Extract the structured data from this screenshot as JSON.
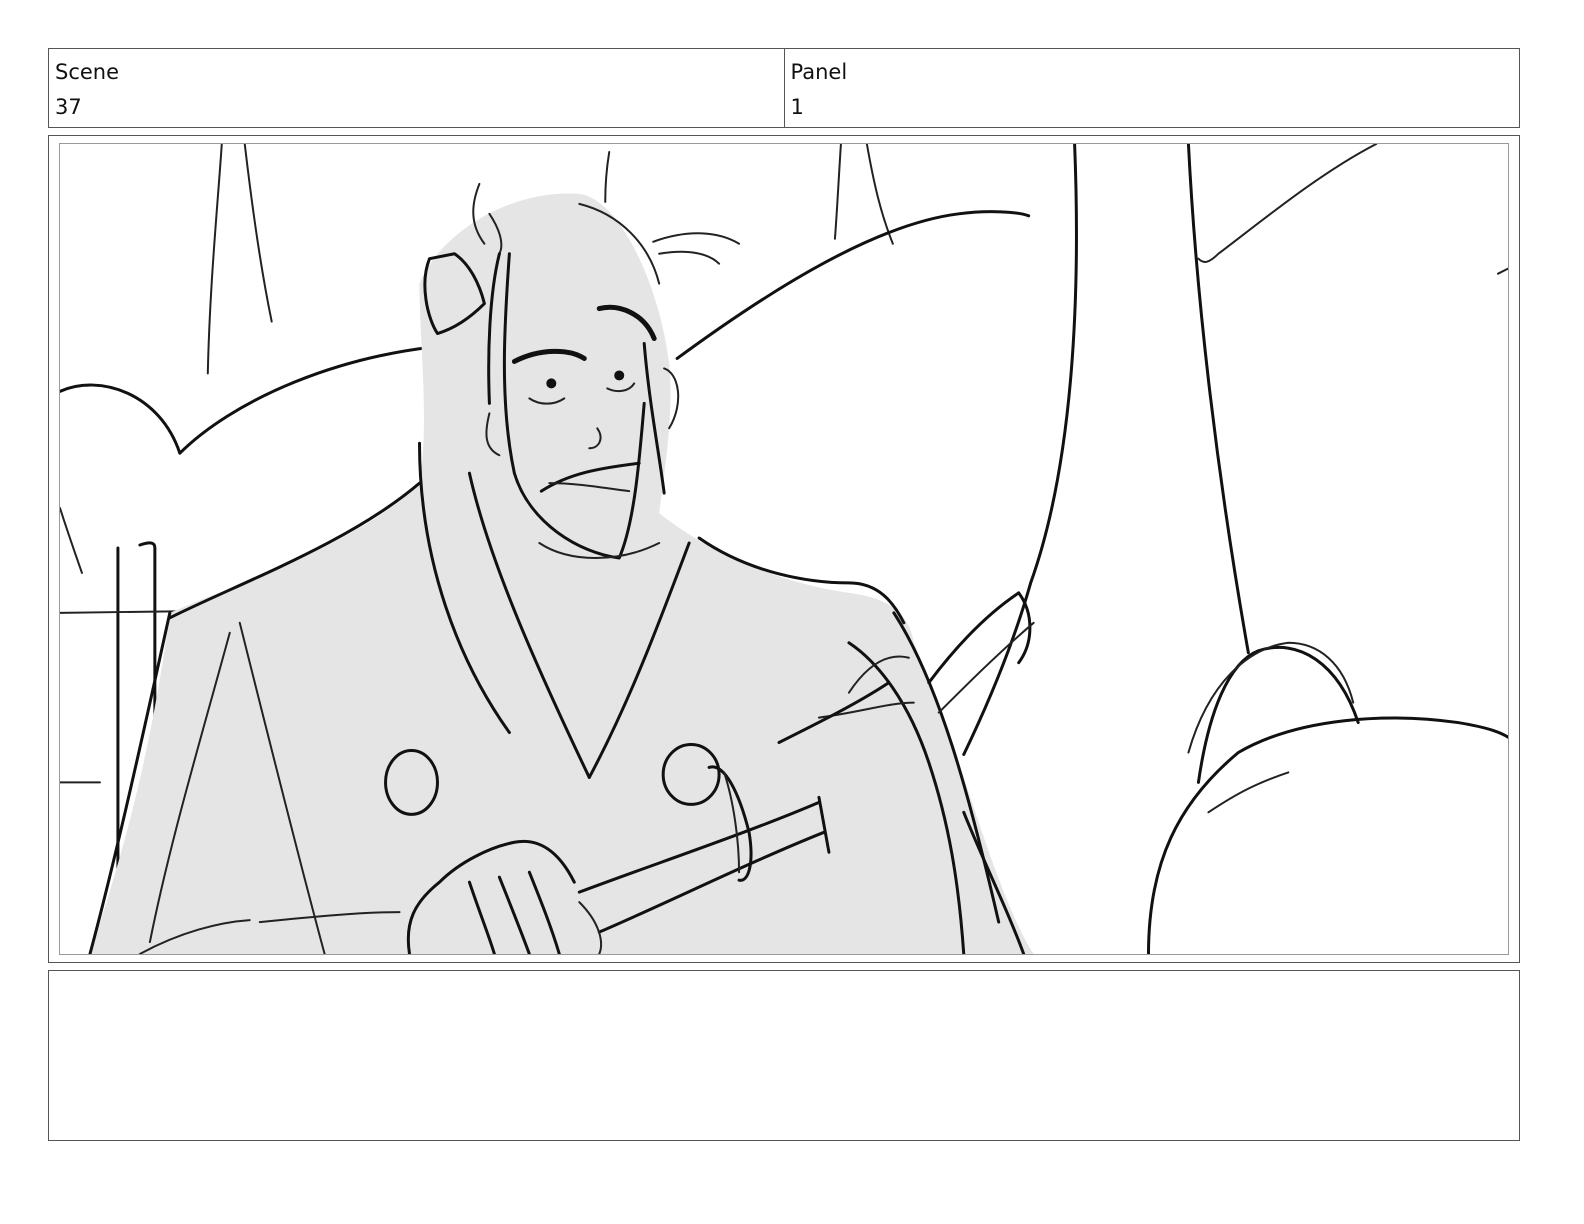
{
  "header": {
    "scene_label": "Scene",
    "scene_value": "37",
    "panel_label": "Panel",
    "panel_value": "1"
  },
  "notes": {
    "text": ""
  }
}
